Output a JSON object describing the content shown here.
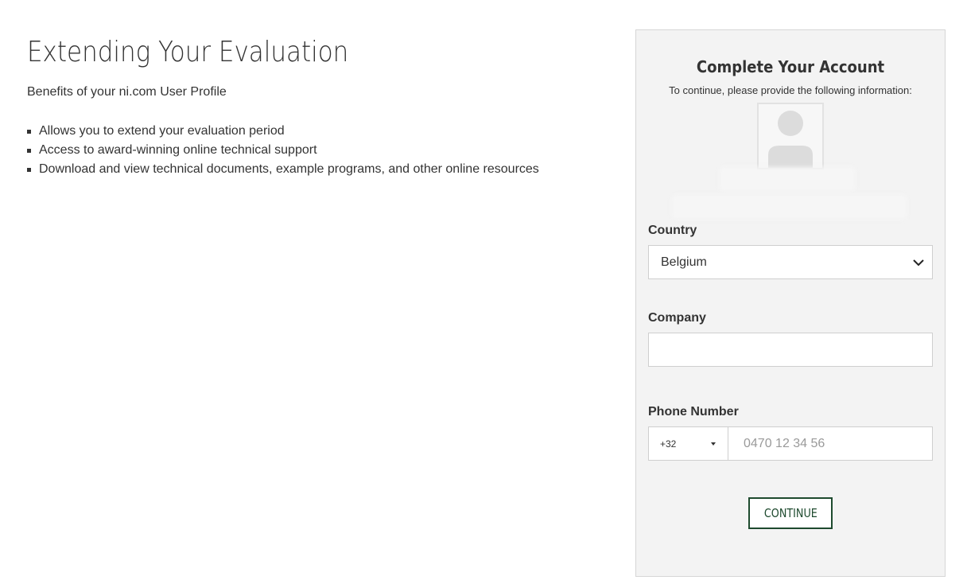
{
  "main": {
    "title": "Extending Your Evaluation",
    "subtitle": "Benefits of your ni.com User Profile",
    "benefits": [
      "Allows you to extend your evaluation period",
      "Access to award-winning online technical support",
      "Download and view technical documents, example programs, and other online resources"
    ]
  },
  "account_panel": {
    "title": "Complete Your Account",
    "instructions": "To continue, please provide the following information:",
    "avatar_icon": "user-avatar-placeholder-icon",
    "country": {
      "label": "Country",
      "selected": "Belgium",
      "icon": "chevron-down-icon"
    },
    "company": {
      "label": "Company",
      "value": ""
    },
    "phone": {
      "label": "Phone Number",
      "country_code": "+32",
      "placeholder": "0470 12 34 56",
      "value": ""
    },
    "continue_label": "CONTINUE",
    "colors": {
      "panel_background": "#f3f3f3",
      "button_accent": "#1e4a2e"
    }
  }
}
